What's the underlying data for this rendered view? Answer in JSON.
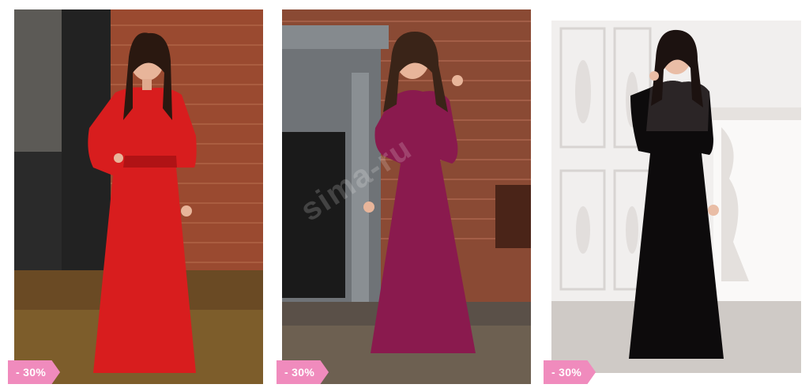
{
  "products": [
    {
      "dress_color": "red",
      "discount_label": "- 30%"
    },
    {
      "dress_color": "burgundy",
      "discount_label": "- 30%"
    },
    {
      "dress_color": "black",
      "discount_label": "- 30%"
    }
  ],
  "badge_color": "#f08bbd",
  "watermark": "sima-ru"
}
